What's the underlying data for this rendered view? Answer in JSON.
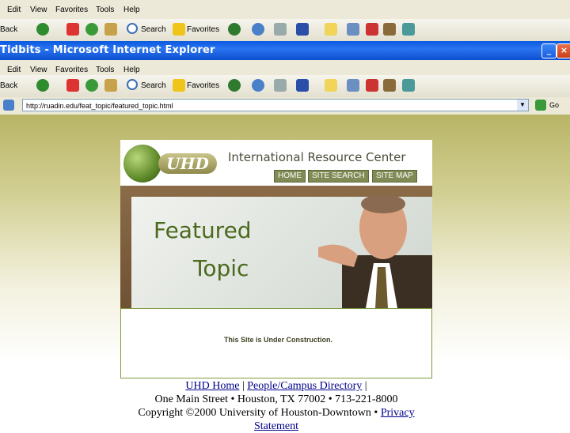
{
  "top_window": {
    "menu": [
      "Edit",
      "View",
      "Favorites",
      "Tools",
      "Help"
    ],
    "toolbar": {
      "back": "Back",
      "search": "Search",
      "favorites": "Favorites"
    }
  },
  "browser": {
    "title": "Tidbits - Microsoft Internet Explorer",
    "menu": [
      "Edit",
      "View",
      "Favorites",
      "Tools",
      "Help"
    ],
    "toolbar": {
      "back": "Back",
      "search": "Search",
      "favorites": "Favorites"
    },
    "address": "http://ruadin.edu/feat_topic/featured_topic.html",
    "go_label": "Go",
    "title_buttons": {
      "minimize": "_",
      "close": "×"
    }
  },
  "site": {
    "logo_text": "UHD",
    "header_title": "International Resource Center",
    "nav": [
      "HOME",
      "SITE SEARCH",
      "SITE MAP"
    ],
    "hero_line1": "Featured",
    "hero_line2": "Topic",
    "construction": "This Site is Under Construction.",
    "footer": {
      "link_home": "UHD Home",
      "sep": "|",
      "link_directory": "People/Campus Directory",
      "sep2": "|",
      "address": "One Main Street • Houston, TX 77002 • 713-221-8000",
      "copyright": "Copyright ©2000 University of Houston-Downtown •",
      "link_privacy": "Privacy",
      "link_statement": "Statement"
    }
  },
  "colors": {
    "titlebar": "#0a5ae0",
    "content_top": "#b8b466",
    "nav_bg": "#7f8a55",
    "hero_text": "#4c6a1d"
  }
}
